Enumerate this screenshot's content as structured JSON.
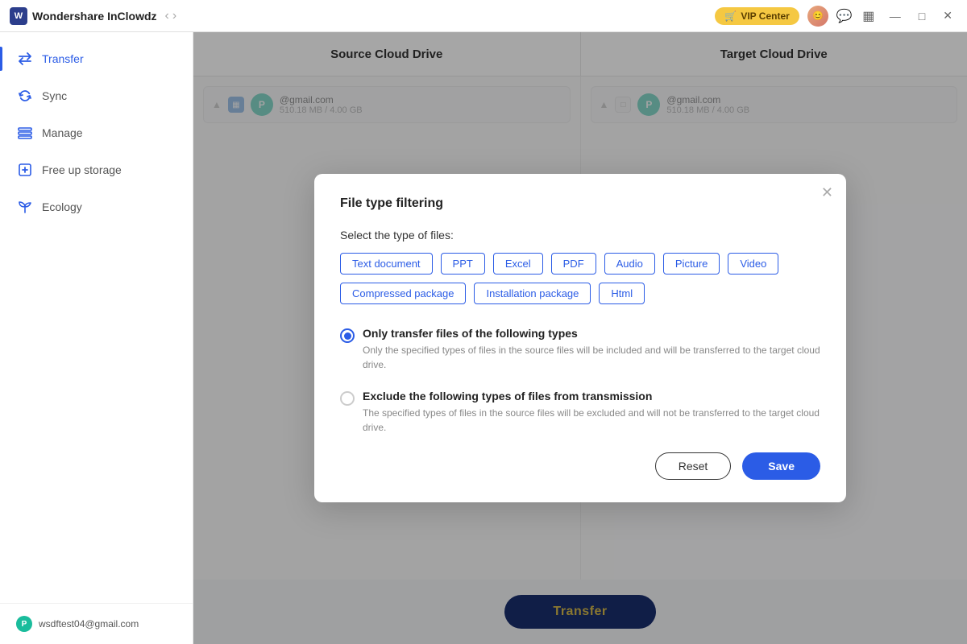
{
  "app": {
    "name": "Wondershare InClowdz",
    "logo_letter": "W"
  },
  "titlebar": {
    "vip_label": "VIP Center",
    "cart_icon": "🛒",
    "nav_back": "‹",
    "nav_forward": "›"
  },
  "sidebar": {
    "items": [
      {
        "id": "transfer",
        "label": "Transfer",
        "active": true
      },
      {
        "id": "sync",
        "label": "Sync",
        "active": false
      },
      {
        "id": "manage",
        "label": "Manage",
        "active": false
      },
      {
        "id": "free-up-storage",
        "label": "Free up storage",
        "active": false
      },
      {
        "id": "ecology",
        "label": "Ecology",
        "active": false
      }
    ],
    "account": {
      "email": "wsdftest04@gmail.com",
      "initial": "P"
    }
  },
  "main": {
    "source_label": "Source Cloud Drive",
    "target_label": "Target Cloud Drive",
    "source_account": {
      "email": "@gmail.com",
      "storage": "510.18 MB / 4.00 GB",
      "initial": "P"
    },
    "target_account": {
      "email": "@gmail.com",
      "storage": "510.18 MB / 4.00 GB",
      "initial": "P"
    },
    "transfer_btn": "Transfer"
  },
  "modal": {
    "title": "File type filtering",
    "section_label": "Select the type of files:",
    "file_types": [
      {
        "id": "text-document",
        "label": "Text document"
      },
      {
        "id": "ppt",
        "label": "PPT"
      },
      {
        "id": "excel",
        "label": "Excel"
      },
      {
        "id": "pdf",
        "label": "PDF"
      },
      {
        "id": "audio",
        "label": "Audio"
      },
      {
        "id": "picture",
        "label": "Picture"
      },
      {
        "id": "video",
        "label": "Video"
      },
      {
        "id": "compressed-package",
        "label": "Compressed package"
      },
      {
        "id": "installation-package",
        "label": "Installation package"
      },
      {
        "id": "html",
        "label": "Html"
      }
    ],
    "options": [
      {
        "id": "only-transfer",
        "label": "Only transfer files of the following types",
        "desc": "Only the specified types of files in the source files will be included and will be transferred to the target cloud drive.",
        "checked": true
      },
      {
        "id": "exclude",
        "label": "Exclude the following types of files from transmission",
        "desc": "The specified types of files in the source files will be excluded and will not be transferred to the target cloud drive.",
        "checked": false
      }
    ],
    "reset_btn": "Reset",
    "save_btn": "Save"
  }
}
